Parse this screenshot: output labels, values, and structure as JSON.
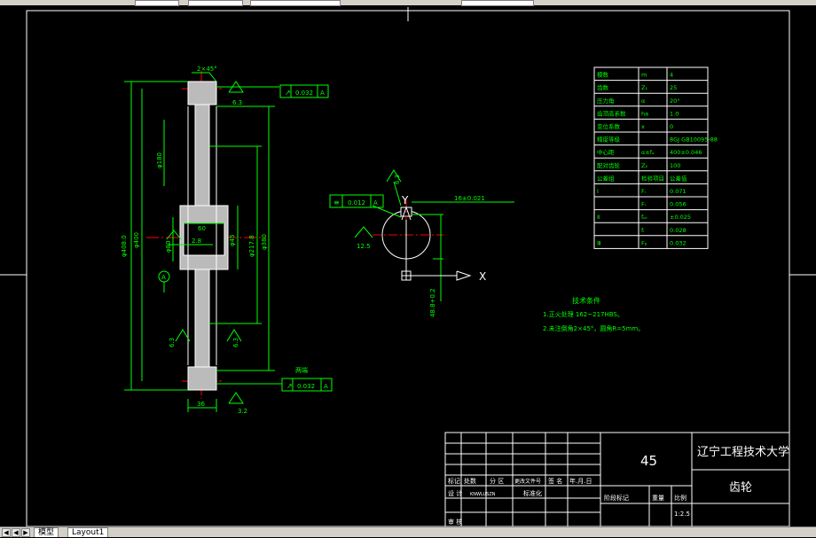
{
  "dimensions": {
    "chamfer_top": "2×45°",
    "runout_top": "0.032",
    "runout_top_datum": "A",
    "rough_top": "6.3",
    "od_left": "φ408.0",
    "od_left2": "φ400",
    "key_dim_small": "φ180",
    "shaft_dim": "φ80",
    "rough_hub_left": "6.3",
    "hub_text": "2.8",
    "hub_length": "60",
    "bore_left_label": "φ45",
    "bore_mid": "φ45",
    "inner_dia": "φ217.8",
    "inner_dia2": "φ380",
    "datum_circle": "A",
    "rough_web_left": "6.3",
    "rough_web_right": "6.3",
    "flatness_label": "两端",
    "runout_bottom": "0.032",
    "runout_bottom_datum": "A",
    "width_bottom": "36",
    "rough_bottom": "3.2",
    "keyway_width": "16±0.021",
    "sym_tol": "0.012",
    "sym_datum": "A",
    "rough_key": "12.5",
    "rough_key_top": "6.3",
    "keyway_depth": "48.8+0.2",
    "axis_x": "X"
  },
  "param_table": [
    [
      "模数",
      "m",
      "4"
    ],
    [
      "齿数",
      "Z₁",
      "25"
    ],
    [
      "压力角",
      "α",
      "20°"
    ],
    [
      "齿顶高系数",
      "ha",
      "1.0"
    ],
    [
      "变位系数",
      "x",
      "0"
    ],
    [
      "精度等级",
      "",
      "8GJ GB10095-88"
    ],
    [
      "中心距",
      "α±fₐ",
      "400±0.046"
    ],
    [
      "配对齿轮",
      "Z₂",
      "100"
    ],
    [
      "公差组",
      "检验项目",
      "公差值"
    ],
    [
      "Ⅰ",
      "Fᵢ",
      "0.071"
    ],
    [
      "",
      "Fᵣ",
      "0.056"
    ],
    [
      "Ⅱ",
      "fₚₜ",
      "±0.025"
    ],
    [
      "",
      "fᵢ",
      "0.028"
    ],
    [
      "Ⅲ",
      "Fᵦ",
      "0.032"
    ]
  ],
  "tech_req": {
    "title": "技术条件",
    "line1": "1.正火处理 162~217HBS。",
    "line2": "2.未注倒角2×45°，圆角R=5mm。"
  },
  "title_block": {
    "material": "45",
    "school": "辽宁工程技术大学",
    "part_name": "齿轮",
    "h_mark": "标记",
    "h_count": "处数",
    "h_zone": "分 区",
    "h_docno": "更改文件号",
    "h_sign": "签 名",
    "h_date": "年.月.日",
    "r_design": "设 计",
    "r_design_name": "KNWLUSZN",
    "r_standard": "标准化",
    "r_review": "审 核",
    "stage_label": "阶段标记",
    "weight_label": "重量",
    "scale_label": "比例",
    "scale_value": "1:2.5"
  },
  "tabs": {
    "model": "模型",
    "layout1": "Layout1"
  },
  "colors": {
    "background": "#000000",
    "border": "#ffffff",
    "geometry": "#ffffff",
    "dimension": "#00ff00",
    "centerline": "#ff0000",
    "section": "#cccccc"
  }
}
